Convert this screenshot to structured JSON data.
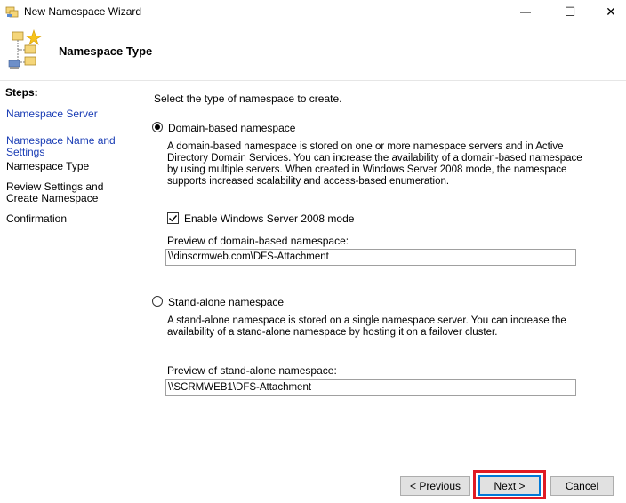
{
  "window": {
    "title": "New Namespace Wizard",
    "minimize_glyph": "—",
    "maximize_glyph": "☐",
    "close_glyph": "✕"
  },
  "header": {
    "title": "Namespace Type"
  },
  "nav": {
    "steps_label": "Steps:",
    "items": [
      {
        "label": "Namespace Server"
      },
      {
        "label": "Namespace Name and Settings"
      },
      {
        "label": "Namespace Type"
      },
      {
        "label": "Review Settings and Create Namespace"
      },
      {
        "label": "Confirmation"
      }
    ]
  },
  "main": {
    "prompt": "Select the type of namespace to create.",
    "domain": {
      "label": "Domain-based namespace",
      "selected": true,
      "description": "A domain-based namespace is stored on one or more namespace servers and in Active Directory Domain Services. You can increase the availability of a domain-based namespace by using multiple servers. When created in Windows Server 2008 mode, the namespace supports increased scalability and access-based enumeration.",
      "enable_2008_label": "Enable Windows Server 2008 mode",
      "enable_2008_checked": true,
      "preview_label": "Preview of domain-based namespace:",
      "preview_value": "\\\\dinscrmweb.com\\DFS-Attachment"
    },
    "standalone": {
      "label": "Stand-alone namespace",
      "selected": false,
      "description": "A stand-alone namespace is stored on a single namespace server. You can increase the availability of a stand-alone namespace by hosting it on a failover cluster.",
      "preview_label": "Preview of stand-alone namespace:",
      "preview_value": "\\\\SCRMWEB1\\DFS-Attachment"
    }
  },
  "footer": {
    "previous_label": "< Previous",
    "next_label": "Next >",
    "cancel_label": "Cancel"
  },
  "colors": {
    "link": "#1a3db5",
    "highlight": "#e01b24",
    "default_button_border": "#0078d7"
  }
}
